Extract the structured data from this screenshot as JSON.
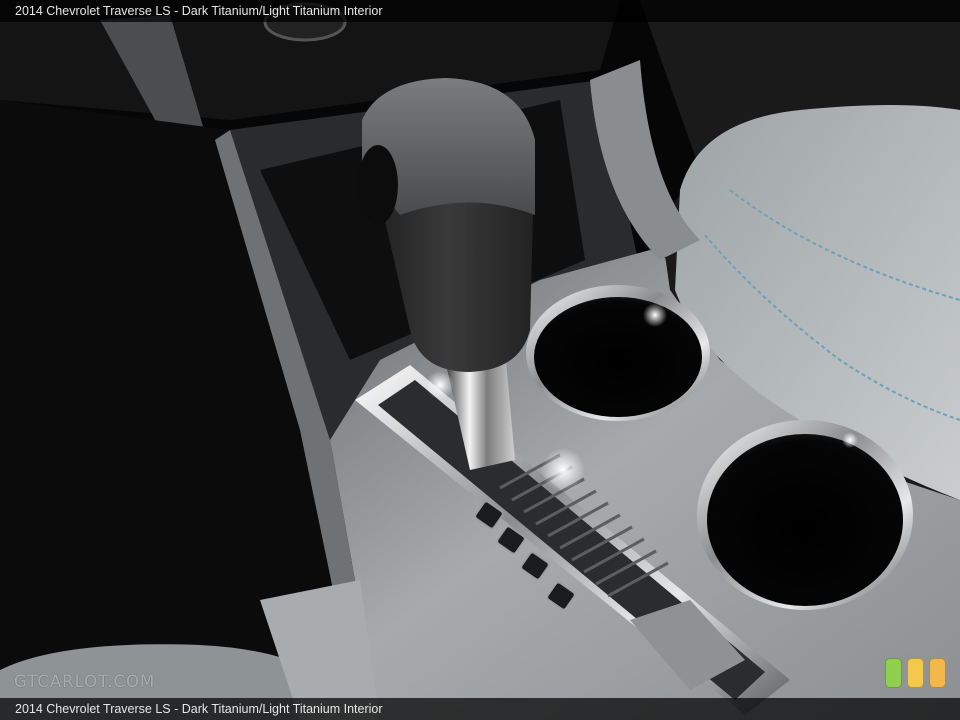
{
  "caption": {
    "top": "2014 Chevrolet Traverse LS - Dark Titanium/Light Titanium Interior",
    "bottom": "2014 Chevrolet Traverse LS - Dark Titanium/Light Titanium Interior"
  },
  "watermark": "GTCARLOT.COM",
  "photo_subject": "automatic gear shifter and two cup holders in center console",
  "badge_colors": [
    "#8fd14f",
    "#f2c94c",
    "#f2b84b"
  ]
}
